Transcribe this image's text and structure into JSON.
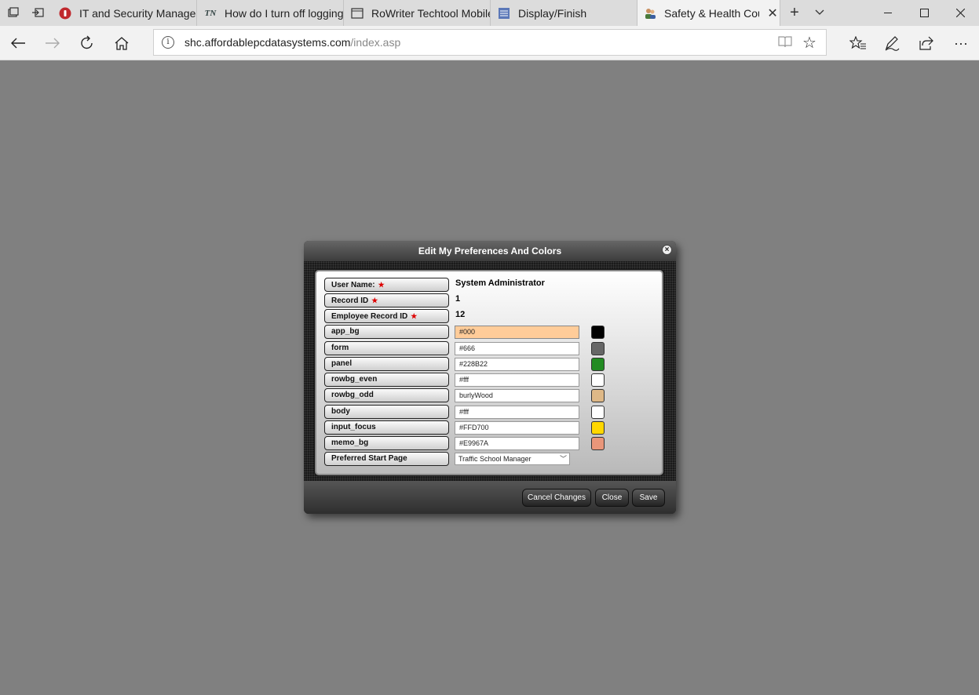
{
  "browser": {
    "tabs": [
      {
        "label": "IT and Security Manager",
        "active": false
      },
      {
        "label": "How do I turn off logging",
        "active": false
      },
      {
        "label": "RoWriter Techtool Mobile",
        "active": false
      },
      {
        "label": "Display/Finish",
        "active": false
      },
      {
        "label": "Safety & Health Cour",
        "active": true
      }
    ],
    "address": {
      "host": "shc.affordablepcdatasystems.com",
      "path": "/index.asp"
    }
  },
  "dialog": {
    "title": "Edit My Preferences And Colors",
    "fields": {
      "user_name": {
        "label": "User Name:",
        "value": "System Administrator"
      },
      "record_id": {
        "label": "Record ID",
        "value": "1"
      },
      "employee_record_id": {
        "label": "Employee Record ID",
        "value": "12"
      }
    },
    "colors": [
      {
        "label": "app_bg",
        "value": "#000",
        "swatch": "#000000"
      },
      {
        "label": "form",
        "value": "#666",
        "swatch": "#666666"
      },
      {
        "label": "panel",
        "value": "#228B22",
        "swatch": "#228B22"
      },
      {
        "label": "rowbg_even",
        "value": "#fff",
        "swatch": "#ffffff"
      },
      {
        "label": "rowbg_odd",
        "value": "burlyWood",
        "swatch": "#DEB887"
      },
      {
        "label": "body",
        "value": "#fff",
        "swatch": "#ffffff"
      },
      {
        "label": "input_focus",
        "value": "#FFD700",
        "swatch": "#FFD700"
      },
      {
        "label": "memo_bg",
        "value": "#E9967A",
        "swatch": "#E9967A"
      }
    ],
    "start_page": {
      "label": "Preferred Start Page",
      "selected": "Traffic School Manager"
    },
    "buttons": {
      "cancel": "Cancel Changes",
      "close": "Close",
      "save": "Save"
    }
  }
}
